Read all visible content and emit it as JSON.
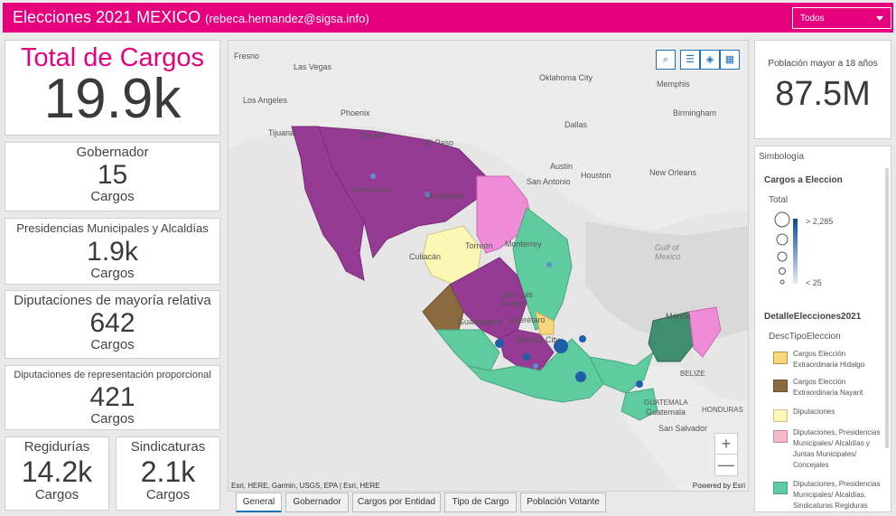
{
  "header": {
    "title": "Elecciones 2021 MEXICO",
    "subtitle": "(rebeca.hernandez@sigsa.info)",
    "dropdown_value": "Todos"
  },
  "cards": {
    "total": {
      "label": "Total de Cargos",
      "value": "19.9k"
    },
    "gobernador": {
      "label": "Gobernador",
      "value": "15",
      "unit": "Cargos"
    },
    "presidencias": {
      "label": "Presidencias Municipales y Alcaldías",
      "value": "1.9k",
      "unit": "Cargos"
    },
    "diputaciones_mr": {
      "label": "Diputaciones de mayoría relativa",
      "value": "642",
      "unit": "Cargos"
    },
    "diputaciones_rp": {
      "label": "Diputaciones de representación proporcional",
      "value": "421",
      "unit": "Cargos"
    },
    "regidurias": {
      "label": "Regidurías",
      "value": "14.2k",
      "unit": "Cargos"
    },
    "sindicaturas": {
      "label": "Sindicaturas",
      "value": "2.1k",
      "unit": "Cargos"
    },
    "poblacion": {
      "label": "Población mayor a 18 años",
      "value": "87.5M"
    }
  },
  "map": {
    "places": [
      "Fresno",
      "Las Vegas",
      "Oklahoma City",
      "Memphis",
      "Los Angeles",
      "Phoenix",
      "Birmingham",
      "Dallas",
      "Tijuana",
      "Tucson",
      "El Paso",
      "Austin",
      "San Antonio",
      "Houston",
      "New Orleans",
      "Hermosillo",
      "Chihuahua",
      "Gulf of Mexico",
      "Torreón",
      "Monterrey",
      "Culiacán",
      "San Luis Potosí",
      "Guadalajara",
      "Querétaro",
      "Mexico City",
      "Mérida",
      "BELIZE",
      "GUATEMALA",
      "Guatemala",
      "HONDURAS",
      "San Salvador"
    ],
    "attribution": "Esri, HERE, Garmin, USGS, EPA | Esri, HERE",
    "powered": "Powered by Esri",
    "zoom_in": "+",
    "zoom_out": "—"
  },
  "tabs": [
    "General",
    "Gobernador",
    "Cargos por Entidad",
    "Tipo de Cargo",
    "Población Votante"
  ],
  "legend": {
    "title": "Simbología",
    "layer1": "Cargos a Eleccion",
    "total_label": "Total",
    "max_label": "> 2,285",
    "min_label": "< 25",
    "layer2": "DetalleElecciones2021",
    "field": "DescTipoEleccion",
    "items": [
      {
        "label": "Cargos Elección Extraordinaria Hidalgo",
        "color": "#f9d67a"
      },
      {
        "label": "Cargos Elección Extraordinaria Nayarit",
        "color": "#8c6a3f"
      },
      {
        "label": "Diputaciones",
        "color": "#fdf7b6"
      },
      {
        "label": "Diputaciones, Presidencias Municipales/ Alcaldías y Juntas Municipales/ Concejales",
        "color": "#f6b9c8"
      },
      {
        "label": "Diputaciones, Presidencias Municipales/ Alcaldías, Sindicaturas Regiduras",
        "color": "#5fcca0"
      }
    ]
  },
  "colors": {
    "accent": "#e6007e",
    "purple": "#953b93",
    "pink": "#f08bd7",
    "green": "#5fcca0",
    "dark_green": "#3f8e6e",
    "yellow": "#fdf7b6",
    "brown": "#8c6a3f",
    "orange": "#f9d67a",
    "blue": "#1f6fb5"
  }
}
